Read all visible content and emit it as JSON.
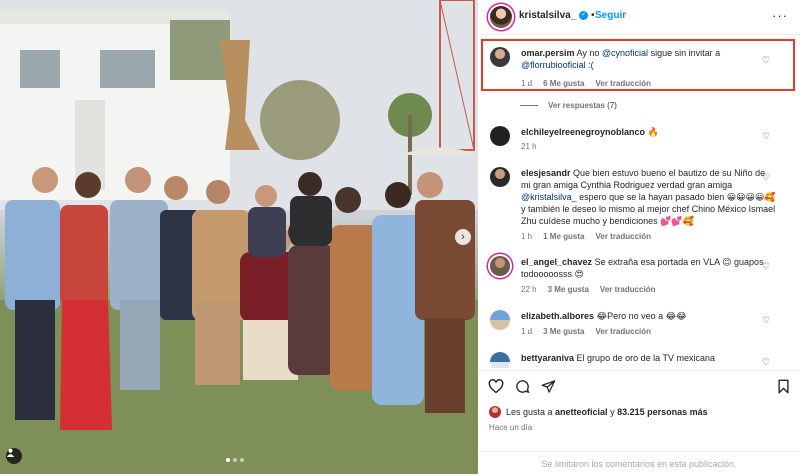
{
  "photo": {
    "next_label": "›",
    "user_icon": "user-tag-icon",
    "slide_count": 3,
    "active_slide": 1
  },
  "header": {
    "username": "kristalsilva_",
    "follow_label": "Seguir",
    "separator": "•",
    "more_label": "···"
  },
  "comments": [
    {
      "user": "omar.persim",
      "parts": [
        "Ay no ",
        "@cynoficial",
        " sigue sin invitar a ",
        "@florrubiooficial",
        " :("
      ],
      "time": "1 d",
      "likes": "6 Me gusta",
      "translate": "Ver traducción",
      "view_replies": "Ver respuestas (7)",
      "highlighted": true
    },
    {
      "user": "elchileyelreenegroynoblanco",
      "parts": [
        "🔥"
      ],
      "time": "21 h"
    },
    {
      "user": "elesjesandr",
      "parts": [
        "Que bien estuvo bueno el bautizo de su Niño de mi gran amiga Cynthia Rodriguez verdad gran amiga ",
        "@kristalsilva_",
        " espero que se la hayan pasado bien 😀😀😀😀🥰 y también le deseo lo mismo al mejor chef Chino México Ismael Zhu cuídese mucho y bendiciones 💕💕🥰"
      ],
      "time": "1 h",
      "likes": "1 Me gusta",
      "translate": "Ver traducción"
    },
    {
      "user": "el_angel_chavez",
      "parts": [
        "Se extraña esa portada en VLA 😉 guapos todooooosss 😍"
      ],
      "time": "22 h",
      "likes": "3 Me gusta",
      "translate": "Ver traducción"
    },
    {
      "user": "elizabeth.albores",
      "parts": [
        "😂Pero no veo a 😂😂"
      ],
      "time": "1 d",
      "likes": "3 Me gusta",
      "translate": "Ver traducción"
    },
    {
      "user": "bettyaraniva",
      "parts": [
        "El grupo de oro de la TV mexicana"
      ]
    }
  ],
  "actions": {
    "like_icon": "heart-icon",
    "comment_icon": "comment-icon",
    "share_icon": "send-icon",
    "save_icon": "bookmark-icon",
    "likes_prefix": "Les gusta a ",
    "likes_user": "anetteoficial",
    "likes_mid": " y ",
    "likes_count": "83.215 personas más",
    "time_ago": "Hace un día",
    "comments_closed": "Se limitaron los comentarios en esta publicación."
  },
  "colors": {
    "accent": "#0095f6",
    "highlight_border": "#e53a2b",
    "mention": "#00376b",
    "muted": "#737373"
  }
}
